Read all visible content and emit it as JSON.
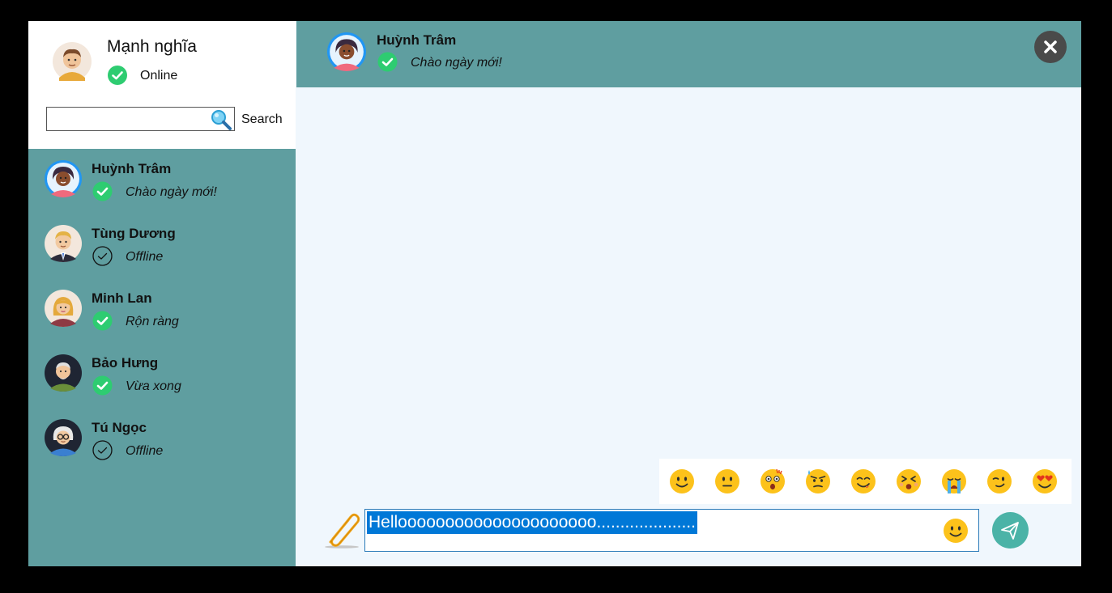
{
  "profile": {
    "name": "Mạnh nghĩa",
    "status": "Online",
    "avatar_icon": "male-avatar-icon"
  },
  "search": {
    "value": "",
    "label": "Search"
  },
  "contacts": [
    {
      "name": "Huỳnh Trâm",
      "status_message": "Chào ngày mới!",
      "online": true,
      "avatar_icon": "female-dark-avatar-icon"
    },
    {
      "name": "Tùng Dương",
      "status_message": "Offline",
      "online": false,
      "avatar_icon": "male-blond-avatar-icon"
    },
    {
      "name": "Minh Lan",
      "status_message": "Rộn ràng",
      "online": true,
      "avatar_icon": "female-blonde-avatar-icon"
    },
    {
      "name": "Bảo Hưng",
      "status_message": "Vừa xong",
      "online": true,
      "avatar_icon": "old-man-avatar-icon"
    },
    {
      "name": "Tú Ngọc",
      "status_message": "Offline",
      "online": false,
      "avatar_icon": "old-woman-glasses-avatar-icon"
    }
  ],
  "chat": {
    "name": "Huỳnh Trâm",
    "status_message": "Chào ngày mới!",
    "online": true
  },
  "composer": {
    "message": "Hellooooooooooooooooooooo....................."
  },
  "emojis": [
    "smile",
    "neutral",
    "shocked",
    "annoyed",
    "yum",
    "dizzy",
    "crying",
    "wink",
    "heart-eyes"
  ],
  "colors": {
    "sidebar": "#5f9ea0",
    "header": "#5f9ea0",
    "chat_bg": "#f0f7fd",
    "online_green": "#2ecc71",
    "send": "#4bb3a7",
    "selection": "#0078d7"
  }
}
